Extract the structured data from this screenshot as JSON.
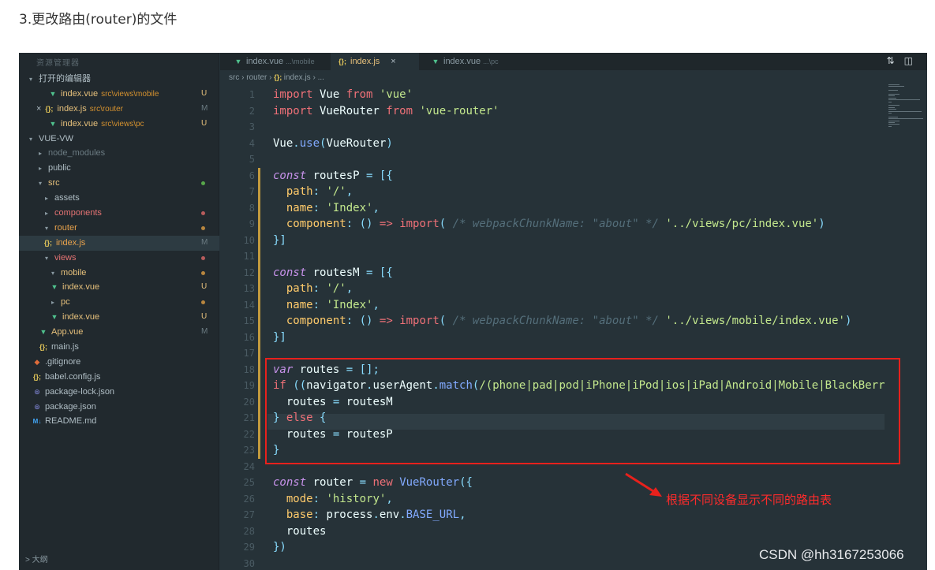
{
  "heading": "3.更改路由(router)的文件",
  "sidebar": {
    "title": "资源管理器",
    "rows": [
      {
        "icon": "chevron-down",
        "label": "打开的编辑器",
        "indent": 8,
        "sel": false
      },
      {
        "icon": "vue",
        "label": "index.vue",
        "path": "src\\views\\mobile",
        "badge": "U",
        "badge_color": "yellow",
        "indent": 36,
        "color": "yellow"
      },
      {
        "icon": "js",
        "prefix": "×",
        "label": "index.js",
        "path": "src\\router",
        "badge": "M",
        "badge_color": "gray",
        "indent": 22,
        "color": "yellow"
      },
      {
        "icon": "vue",
        "label": "index.vue",
        "path": "src\\views\\pc",
        "badge": "U",
        "badge_color": "yellow",
        "indent": 36,
        "color": "yellow"
      },
      {
        "icon": "chevron-down",
        "label": "VUE-VW",
        "indent": 8
      },
      {
        "icon": "chevron-right",
        "label": "node_modules",
        "indent": 20,
        "color": "gray"
      },
      {
        "icon": "chevron-right",
        "label": "public",
        "indent": 20
      },
      {
        "icon": "chevron-down",
        "label": "src",
        "indent": 20,
        "color": "yellow",
        "dot": "green"
      },
      {
        "icon": "chevron-right",
        "label": "assets",
        "indent": 28
      },
      {
        "icon": "chevron-right",
        "label": "components",
        "indent": 28,
        "color": "red",
        "dot": "red"
      },
      {
        "icon": "chevron-down",
        "label": "router",
        "indent": 28,
        "color": "orange",
        "dot": "orange"
      },
      {
        "icon": "js",
        "label": "index.js",
        "badge": "M",
        "badge_color": "gray",
        "indent": 30,
        "color": "orange",
        "sel": true
      },
      {
        "icon": "chevron-down",
        "label": "views",
        "indent": 28,
        "color": "red",
        "dot": "red"
      },
      {
        "icon": "chevron-down",
        "label": "mobile",
        "indent": 36,
        "color": "yellow",
        "dot": "orange"
      },
      {
        "icon": "vue",
        "label": "index.vue",
        "badge": "U",
        "badge_color": "yellow",
        "indent": 38,
        "color": "yellow"
      },
      {
        "icon": "chevron-right",
        "label": "pc",
        "indent": 36,
        "color": "yellow",
        "dot": "orange"
      },
      {
        "icon": "vue",
        "label": "index.vue",
        "badge": "U",
        "badge_color": "yellow",
        "indent": 38,
        "color": "yellow"
      },
      {
        "icon": "vue",
        "label": "App.vue",
        "badge": "M",
        "badge_color": "gray",
        "indent": 24,
        "color": "yellow"
      },
      {
        "icon": "js",
        "label": "main.js",
        "indent": 24
      },
      {
        "icon": "git",
        "label": ".gitignore",
        "indent": 16
      },
      {
        "icon": "js",
        "label": "babel.config.js",
        "indent": 16
      },
      {
        "icon": "pkg",
        "label": "package-lock.json",
        "indent": 16
      },
      {
        "icon": "pkg",
        "label": "package.json",
        "indent": 16
      },
      {
        "icon": "md",
        "label": "README.md",
        "indent": 16
      }
    ],
    "outline": "> 大纲"
  },
  "tabs": [
    {
      "icon": "vue",
      "label": "index.vue",
      "sub": "...\\mobile"
    },
    {
      "icon": "js",
      "label": "index.js",
      "active": true,
      "close": "×"
    },
    {
      "icon": "vue",
      "label": "index.vue",
      "sub": "...\\pc"
    }
  ],
  "breadcrumb": [
    "src",
    "router",
    "index.js",
    "..."
  ],
  "icons": {
    "vue": "▼",
    "js": "{};",
    "git": "◆",
    "pkg": "⊚",
    "md": "M↓",
    "chevron-down": "▾",
    "chevron-right": "▸"
  },
  "code": [
    {
      "n": 1,
      "t": [
        [
          "kw",
          "import"
        ],
        [
          "p",
          " Vue "
        ],
        [
          "kw",
          "from"
        ],
        [
          "p",
          " "
        ],
        [
          "str",
          "'vue'"
        ]
      ]
    },
    {
      "n": 2,
      "t": [
        [
          "kw",
          "import"
        ],
        [
          "p",
          " VueRouter "
        ],
        [
          "kw",
          "from"
        ],
        [
          "p",
          " "
        ],
        [
          "str",
          "'vue-router'"
        ]
      ]
    },
    {
      "n": 3,
      "t": []
    },
    {
      "n": 4,
      "t": [
        [
          "p",
          "Vue"
        ],
        [
          "op",
          "."
        ],
        [
          "fn",
          "use"
        ],
        [
          "punc",
          "("
        ],
        [
          "p",
          "VueRouter"
        ],
        [
          "punc",
          ")"
        ]
      ]
    },
    {
      "n": 5,
      "t": []
    },
    {
      "n": 6,
      "t": [
        [
          "kw2",
          "const"
        ],
        [
          "p",
          " routesP "
        ],
        [
          "op",
          "="
        ],
        [
          "p",
          " "
        ],
        [
          "punc",
          "[{"
        ]
      ]
    },
    {
      "n": 7,
      "t": [
        [
          "p",
          "  "
        ],
        [
          "prop",
          "path"
        ],
        [
          "op",
          ":"
        ],
        [
          "p",
          " "
        ],
        [
          "str",
          "'/'"
        ],
        [
          "op",
          ","
        ]
      ]
    },
    {
      "n": 8,
      "t": [
        [
          "p",
          "  "
        ],
        [
          "prop",
          "name"
        ],
        [
          "op",
          ":"
        ],
        [
          "p",
          " "
        ],
        [
          "str",
          "'Index'"
        ],
        [
          "op",
          ","
        ]
      ]
    },
    {
      "n": 9,
      "t": [
        [
          "p",
          "  "
        ],
        [
          "prop",
          "component"
        ],
        [
          "op",
          ":"
        ],
        [
          "p",
          " "
        ],
        [
          "punc",
          "()"
        ],
        [
          "p",
          " "
        ],
        [
          "kw",
          "=>"
        ],
        [
          "p",
          " "
        ],
        [
          "kw",
          "import"
        ],
        [
          "punc",
          "("
        ],
        [
          "p",
          " "
        ],
        [
          "cm",
          "/* webpackChunkName: \"about\" */"
        ],
        [
          "p",
          " "
        ],
        [
          "str",
          "'../views/pc/index.vue'"
        ],
        [
          "punc",
          ")"
        ]
      ]
    },
    {
      "n": 10,
      "t": [
        [
          "punc",
          "}]"
        ]
      ]
    },
    {
      "n": 11,
      "t": []
    },
    {
      "n": 12,
      "t": [
        [
          "kw2",
          "const"
        ],
        [
          "p",
          " routesM "
        ],
        [
          "op",
          "="
        ],
        [
          "p",
          " "
        ],
        [
          "punc",
          "[{"
        ]
      ]
    },
    {
      "n": 13,
      "t": [
        [
          "p",
          "  "
        ],
        [
          "prop",
          "path"
        ],
        [
          "op",
          ":"
        ],
        [
          "p",
          " "
        ],
        [
          "str",
          "'/'"
        ],
        [
          "op",
          ","
        ]
      ]
    },
    {
      "n": 14,
      "t": [
        [
          "p",
          "  "
        ],
        [
          "prop",
          "name"
        ],
        [
          "op",
          ":"
        ],
        [
          "p",
          " "
        ],
        [
          "str",
          "'Index'"
        ],
        [
          "op",
          ","
        ]
      ]
    },
    {
      "n": 15,
      "t": [
        [
          "p",
          "  "
        ],
        [
          "prop",
          "component"
        ],
        [
          "op",
          ":"
        ],
        [
          "p",
          " "
        ],
        [
          "punc",
          "()"
        ],
        [
          "p",
          " "
        ],
        [
          "kw",
          "=>"
        ],
        [
          "p",
          " "
        ],
        [
          "kw",
          "import"
        ],
        [
          "punc",
          "("
        ],
        [
          "p",
          " "
        ],
        [
          "cm",
          "/* webpackChunkName: \"about\" */"
        ],
        [
          "p",
          " "
        ],
        [
          "str",
          "'../views/mobile/index.vue'"
        ],
        [
          "punc",
          ")"
        ]
      ]
    },
    {
      "n": 16,
      "t": [
        [
          "punc",
          "}]"
        ]
      ]
    },
    {
      "n": 17,
      "t": []
    },
    {
      "n": 18,
      "t": [
        [
          "kw2",
          "var"
        ],
        [
          "p",
          " routes "
        ],
        [
          "op",
          "="
        ],
        [
          "p",
          " "
        ],
        [
          "punc",
          "[];"
        ]
      ]
    },
    {
      "n": 19,
      "t": [
        [
          "kw",
          "if"
        ],
        [
          "p",
          " "
        ],
        [
          "punc",
          "(("
        ],
        [
          "p",
          "navigator"
        ],
        [
          "op",
          "."
        ],
        [
          "p",
          "userAgent"
        ],
        [
          "op",
          "."
        ],
        [
          "fn",
          "match"
        ],
        [
          "punc",
          "("
        ],
        [
          "str",
          "/(phone|pad|pod|iPhone|iPod|ios|iPad|Android|Mobile|BlackBerr"
        ]
      ]
    },
    {
      "n": 20,
      "t": [
        [
          "p",
          "  routes "
        ],
        [
          "op",
          "="
        ],
        [
          "p",
          " routesM"
        ]
      ]
    },
    {
      "n": 21,
      "t": [
        [
          "punc",
          "}"
        ],
        [
          "p",
          " "
        ],
        [
          "kw",
          "else"
        ],
        [
          "p",
          " "
        ],
        [
          "punc",
          "{"
        ]
      ]
    },
    {
      "n": 22,
      "t": [
        [
          "p",
          "  routes "
        ],
        [
          "op",
          "="
        ],
        [
          "p",
          " routesP"
        ]
      ]
    },
    {
      "n": 23,
      "t": [
        [
          "punc",
          "}"
        ]
      ]
    },
    {
      "n": 24,
      "t": []
    },
    {
      "n": 25,
      "t": [
        [
          "kw2",
          "const"
        ],
        [
          "p",
          " router "
        ],
        [
          "op",
          "="
        ],
        [
          "p",
          " "
        ],
        [
          "kw",
          "new"
        ],
        [
          "p",
          " "
        ],
        [
          "fn",
          "VueRouter"
        ],
        [
          "punc",
          "({"
        ]
      ]
    },
    {
      "n": 26,
      "t": [
        [
          "p",
          "  "
        ],
        [
          "prop",
          "mode"
        ],
        [
          "op",
          ":"
        ],
        [
          "p",
          " "
        ],
        [
          "str",
          "'history'"
        ],
        [
          "op",
          ","
        ]
      ]
    },
    {
      "n": 27,
      "t": [
        [
          "p",
          "  "
        ],
        [
          "prop",
          "base"
        ],
        [
          "op",
          ":"
        ],
        [
          "p",
          " process"
        ],
        [
          "op",
          "."
        ],
        [
          "p",
          "env"
        ],
        [
          "op",
          "."
        ],
        [
          "fn",
          "BASE_URL"
        ],
        [
          "op",
          ","
        ]
      ]
    },
    {
      "n": 28,
      "t": [
        [
          "p",
          "  routes"
        ]
      ]
    },
    {
      "n": 29,
      "t": [
        [
          "punc",
          "})"
        ]
      ]
    },
    {
      "n": 30,
      "t": []
    }
  ],
  "annotation": "根据不同设备显示不同的路由表",
  "watermark": "CSDN @hh3167253066",
  "colors": {
    "accent_red": "#e8211c",
    "editor_bg": "#263238",
    "sidebar_bg": "#21292e"
  }
}
